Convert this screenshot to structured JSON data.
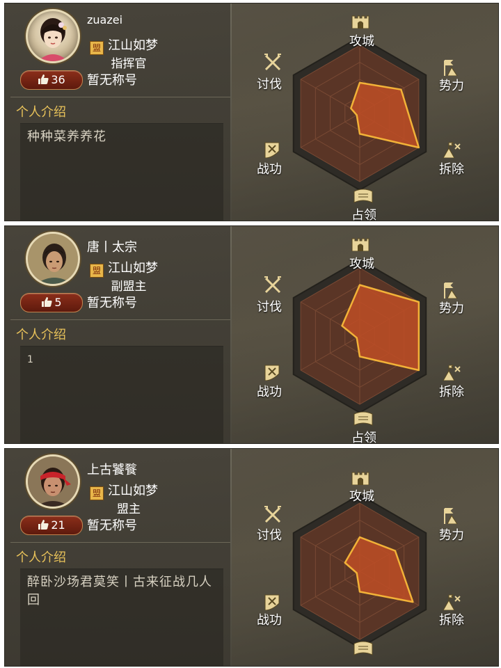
{
  "cards": [
    {
      "player_name": "zuazei",
      "alliance": "江山如梦",
      "role": "指挥官",
      "title": "暂无称号",
      "likes": "36",
      "intro_label": "个人介绍",
      "intro_text": "种种菜养养花",
      "radar": {
        "attack_city": "攻城",
        "influence": "势力",
        "demolish": "拆除",
        "occupy": "占领",
        "merit": "战功",
        "crusade": "讨伐",
        "values": {
          "attack_city": 0.45,
          "influence": 0.7,
          "demolish": 1.0,
          "occupy": 0.3,
          "merit": 0.05,
          "crusade": 0.15
        }
      }
    },
    {
      "player_name": "唐丨太宗",
      "alliance": "江山如梦",
      "role": "副盟主",
      "title": "暂无称号",
      "likes": "5",
      "intro_label": "个人介绍",
      "intro_text": "1",
      "radar": {
        "attack_city": "攻城",
        "influence": "势力",
        "demolish": "拆除",
        "occupy": "占领",
        "merit": "战功",
        "crusade": "讨伐",
        "values": {
          "attack_city": 0.75,
          "influence": 1.0,
          "demolish": 1.0,
          "occupy": 0.3,
          "merit": 0.05,
          "crusade": 0.3
        }
      }
    },
    {
      "player_name": "上古饕餮",
      "alliance": "江山如梦",
      "role": "盟主",
      "title": "暂无称号",
      "likes": "21",
      "intro_label": "个人介绍",
      "intro_text": "醉卧沙场君莫笑丨古来征战几人回",
      "radar": {
        "attack_city": "攻城",
        "influence": "势力",
        "demolish": "拆除",
        "occupy": "占领",
        "merit": "战功",
        "crusade": "讨伐",
        "values": {
          "attack_city": 0.5,
          "influence": 0.6,
          "demolish": 0.9,
          "occupy": 0.3,
          "merit": 0.05,
          "crusade": 0.25
        }
      }
    }
  ]
}
